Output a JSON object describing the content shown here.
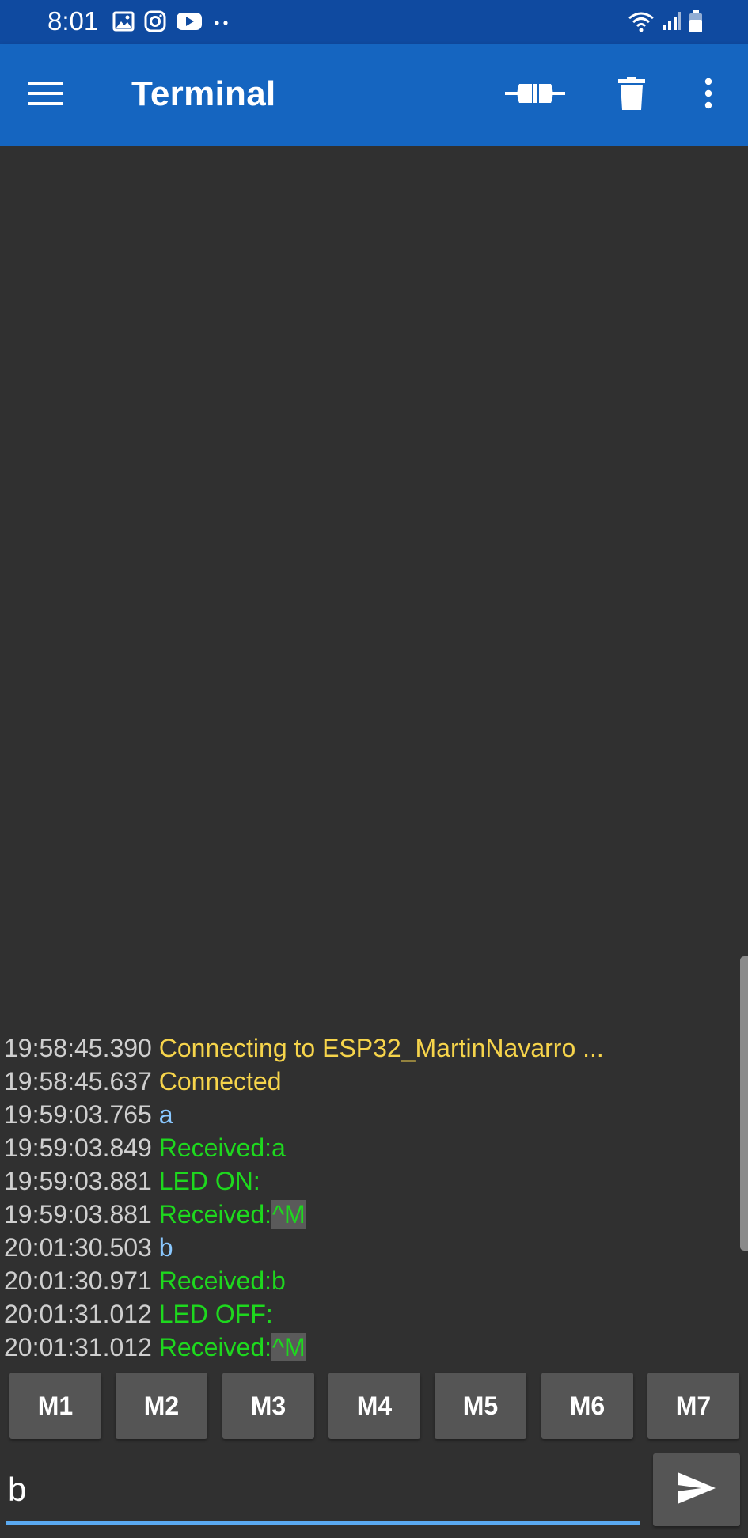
{
  "status_bar": {
    "time": "8:01",
    "left_icons": [
      "image-icon",
      "instagram-icon",
      "youtube-icon",
      "more-dots-icon"
    ],
    "right_icons": [
      "wifi-icon",
      "signal-icon",
      "battery-icon"
    ]
  },
  "app_bar": {
    "title": "Terminal",
    "icons": [
      "menu-icon",
      "connect-plug-icon",
      "trash-icon",
      "overflow-menu-icon"
    ]
  },
  "colors": {
    "status_bar": "#0f4aa0",
    "app_bar": "#1565c0",
    "background": "#303030",
    "timestamp": "#cfcfcf",
    "status_text": "#f6d44b",
    "sent_text": "#8ac8ff",
    "received_text": "#1ed81e",
    "button": "#555555",
    "input_underline": "#5aa9f0"
  },
  "log": [
    {
      "timestamp": "19:58:45.390",
      "type": "status",
      "text": "Connecting to ESP32_MartinNavarro ...",
      "ctrl": ""
    },
    {
      "timestamp": "19:58:45.637",
      "type": "status",
      "text": "Connected",
      "ctrl": ""
    },
    {
      "timestamp": "19:59:03.765",
      "type": "sent",
      "text": "a",
      "ctrl": ""
    },
    {
      "timestamp": "19:59:03.849",
      "type": "recv",
      "text": "Received:a",
      "ctrl": ""
    },
    {
      "timestamp": "19:59:03.881",
      "type": "recv",
      "text": "LED ON:",
      "ctrl": ""
    },
    {
      "timestamp": "19:59:03.881",
      "type": "recv",
      "text": "Received:",
      "ctrl": "^M"
    },
    {
      "timestamp": "20:01:30.503",
      "type": "sent",
      "text": "b",
      "ctrl": ""
    },
    {
      "timestamp": "20:01:30.971",
      "type": "recv",
      "text": "Received:b",
      "ctrl": ""
    },
    {
      "timestamp": "20:01:31.012",
      "type": "recv",
      "text": "LED OFF:",
      "ctrl": ""
    },
    {
      "timestamp": "20:01:31.012",
      "type": "recv",
      "text": "Received:",
      "ctrl": "^M"
    }
  ],
  "macros": [
    "M1",
    "M2",
    "M3",
    "M4",
    "M5",
    "M6",
    "M7"
  ],
  "input": {
    "value": "b",
    "send_icon": "send-icon"
  }
}
